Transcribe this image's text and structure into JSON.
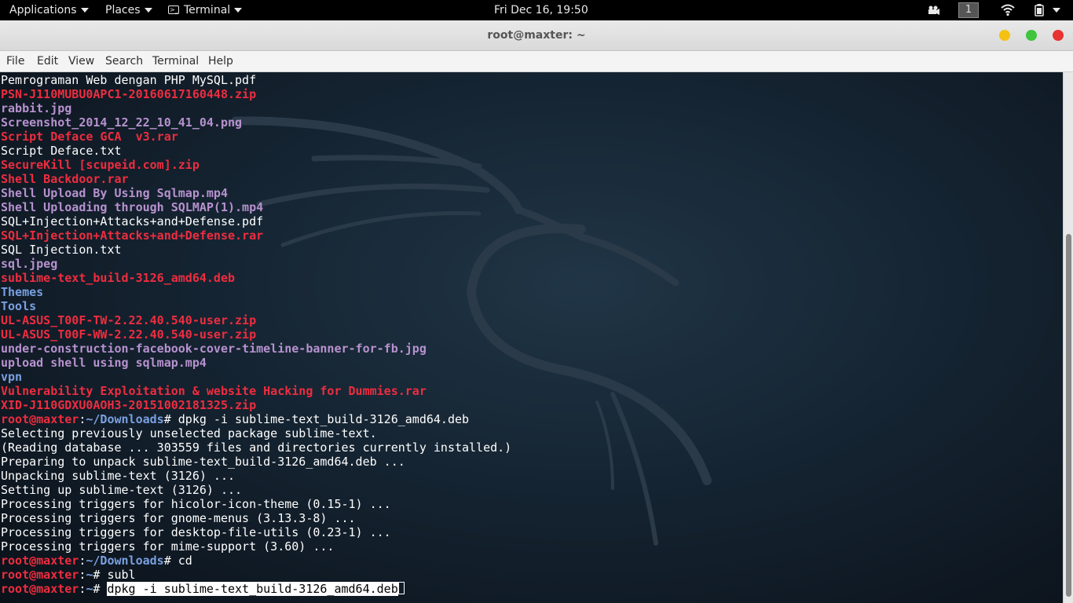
{
  "topbar": {
    "applications": "Applications",
    "places": "Places",
    "terminal": "Terminal",
    "clock": "Fri Dec 16, 19:50",
    "workspace": "1",
    "icons": [
      "video-cam-icon",
      "wifi-icon",
      "battery-icon",
      "power-menu-icon"
    ]
  },
  "window": {
    "title": "root@maxter: ~",
    "controls": {
      "minimize_color": "#f5c211",
      "maximize_color": "#41c43e",
      "close_color": "#e8322f"
    }
  },
  "menubar": [
    "File",
    "Edit",
    "View",
    "Search",
    "Terminal",
    "Help"
  ],
  "colors": {
    "red": "#ee2d3f",
    "magenta": "#b792cf",
    "blue": "#7aa0e0",
    "text": "#ffffff"
  },
  "terminal": {
    "lines": [
      {
        "color": "plain",
        "text": "Pemrograman Web dengan PHP MySQL.pdf"
      },
      {
        "color": "red",
        "text": "PSN-J110MUBU0APC1-20160617160448.zip"
      },
      {
        "color": "mag",
        "text": "rabbit.jpg"
      },
      {
        "color": "mag",
        "text": "Screenshot_2014_12_22_10_41_04.png"
      },
      {
        "color": "red",
        "text": "Script Deface GCA  v3.rar"
      },
      {
        "color": "plain",
        "text": "Script Deface.txt"
      },
      {
        "color": "red",
        "text": "SecureKill [scupeid.com].zip"
      },
      {
        "color": "red",
        "text": "Shell Backdoor.rar"
      },
      {
        "color": "mag",
        "text": "Shell Upload By Using Sqlmap.mp4"
      },
      {
        "color": "mag",
        "text": "Shell Uploading through SQLMAP(1).mp4"
      },
      {
        "color": "plain",
        "text": "SQL+Injection+Attacks+and+Defense.pdf"
      },
      {
        "color": "red",
        "text": "SQL+Injection+Attacks+and+Defense.rar"
      },
      {
        "color": "plain",
        "text": "SQL Injection.txt"
      },
      {
        "color": "mag",
        "text": "sql.jpeg"
      },
      {
        "color": "red",
        "text": "sublime-text_build-3126_amd64.deb"
      },
      {
        "color": "blue",
        "text": "Themes"
      },
      {
        "color": "blue",
        "text": "Tools"
      },
      {
        "color": "red",
        "text": "UL-ASUS_T00F-TW-2.22.40.540-user.zip"
      },
      {
        "color": "red",
        "text": "UL-ASUS_T00F-WW-2.22.40.540-user.zip"
      },
      {
        "color": "mag",
        "text": "under-construction-facebook-cover-timeline-banner-for-fb.jpg"
      },
      {
        "color": "mag",
        "text": "upload shell using sqlmap.mp4"
      },
      {
        "color": "blue",
        "text": "vpn"
      },
      {
        "color": "red",
        "text": "Vulnerability Exploitation & website Hacking for Dummies.rar"
      },
      {
        "color": "red",
        "text": "XID-J110GDXU0AOH3-20151002181325.zip"
      },
      {
        "prompt": {
          "user": "root@maxter",
          "sep": ":",
          "path": "~/Downloads",
          "sym": "# ",
          "cmd": "dpkg -i sublime-text_build-3126_amd64.deb"
        }
      },
      {
        "color": "plain",
        "text": "Selecting previously unselected package sublime-text."
      },
      {
        "color": "plain",
        "text": "(Reading database ... 303559 files and directories currently installed.)"
      },
      {
        "color": "plain",
        "text": "Preparing to unpack sublime-text_build-3126_amd64.deb ..."
      },
      {
        "color": "plain",
        "text": "Unpacking sublime-text (3126) ..."
      },
      {
        "color": "plain",
        "text": "Setting up sublime-text (3126) ..."
      },
      {
        "color": "plain",
        "text": "Processing triggers for hicolor-icon-theme (0.15-1) ..."
      },
      {
        "color": "plain",
        "text": "Processing triggers for gnome-menus (3.13.3-8) ..."
      },
      {
        "color": "plain",
        "text": "Processing triggers for desktop-file-utils (0.23-1) ..."
      },
      {
        "color": "plain",
        "text": "Processing triggers for mime-support (3.60) ..."
      },
      {
        "prompt": {
          "user": "root@maxter",
          "sep": ":",
          "path": "~/Downloads",
          "sym": "# ",
          "cmd": "cd"
        }
      },
      {
        "prompt": {
          "user": "root@maxter",
          "sep": ":",
          "path": "~",
          "sym": "# ",
          "cmd": "subl"
        }
      },
      {
        "prompt": {
          "user": "root@maxter",
          "sep": ":",
          "path": "~",
          "sym": "# ",
          "selected": "dpkg -i sublime-text_build-3126_amd64.deb",
          "cursor": true
        }
      }
    ]
  }
}
